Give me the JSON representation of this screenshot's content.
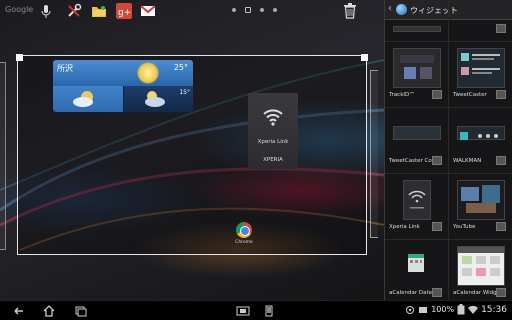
{
  "topbar": {
    "search_label": "Google",
    "icons": [
      "microphone-icon",
      "tools-icon",
      "folder-icon",
      "google-plus-icon",
      "gmail-icon",
      "trash-icon"
    ]
  },
  "home": {
    "weather": {
      "city": "所沢",
      "temp_now": "25°",
      "temp_next": "15°"
    },
    "xperia_link": {
      "title": "Xperia Link",
      "brand": "XPERIA"
    },
    "chrome": {
      "label": "Chrome"
    }
  },
  "drawer": {
    "title": "ウィジェット",
    "widgets": [
      {
        "label": ""
      },
      {
        "label": ""
      },
      {
        "label": "TrackID™"
      },
      {
        "label": "TweetCaster"
      },
      {
        "label": "TweetCaster Co"
      },
      {
        "label": "WALKMAN"
      },
      {
        "label": "Xperia Link"
      },
      {
        "label": "YouTube"
      },
      {
        "label": "aCalendar Date"
      },
      {
        "label": "aCalendar Widg"
      }
    ]
  },
  "statusbar": {
    "battery": "100%",
    "time": "15:36"
  },
  "colors": {
    "drawer_bg": "#161618",
    "frame": "#e6e6e6",
    "accent_blue": "#2a66ad"
  }
}
